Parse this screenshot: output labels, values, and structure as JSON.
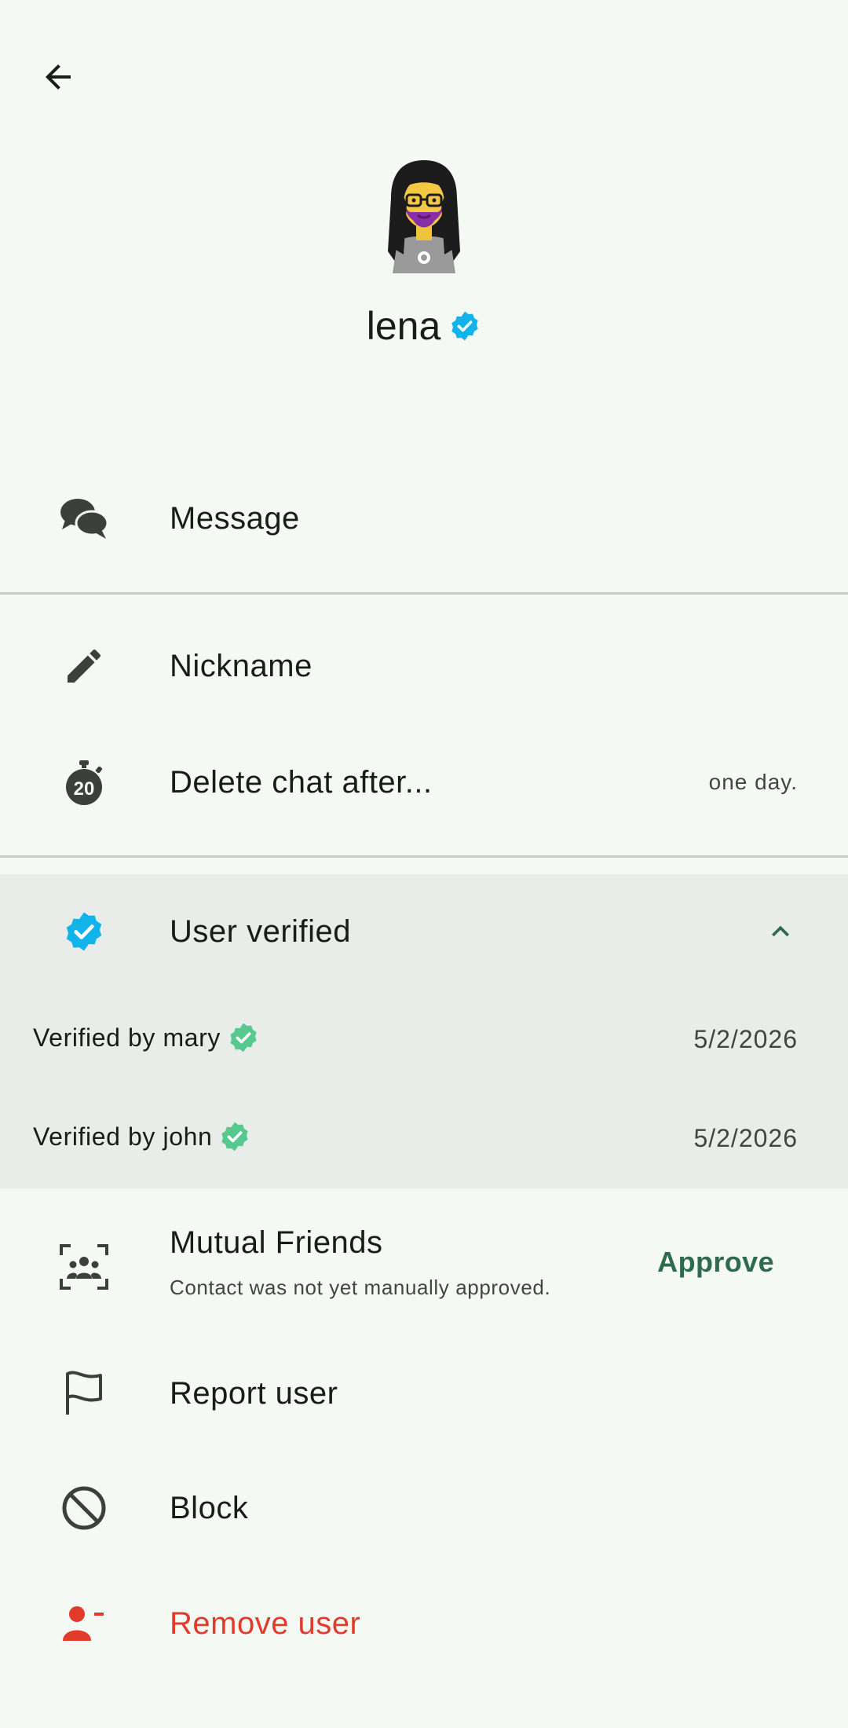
{
  "profile": {
    "name": "lena"
  },
  "actions": {
    "message_label": "Message",
    "nickname_label": "Nickname",
    "delete_chat_label": "Delete chat after...",
    "delete_chat_value": "one day.",
    "timer_badge": "20"
  },
  "verification": {
    "header_label": "User verified",
    "entries": [
      {
        "text": "Verified by mary",
        "date": "5/2/2026"
      },
      {
        "text": "Verified by john",
        "date": "5/2/2026"
      }
    ]
  },
  "mutual": {
    "label": "Mutual Friends",
    "subtitle": "Contact was not yet manually approved.",
    "approve_label": "Approve"
  },
  "more": {
    "report_label": "Report user",
    "block_label": "Block",
    "remove_label": "Remove user"
  },
  "colors": {
    "background": "#f4f9f4",
    "panel": "#e9ede9",
    "verified_blue": "#12b3ea",
    "verified_green": "#57c98f",
    "accent": "#2e6a4c",
    "danger": "#e03b2b"
  },
  "icons": [
    "back-arrow-icon",
    "verified-badge-icon",
    "chat-bubbles-icon",
    "pencil-icon",
    "timer-icon",
    "chevron-up-icon",
    "group-scan-icon",
    "flag-icon",
    "block-icon",
    "remove-user-icon"
  ]
}
